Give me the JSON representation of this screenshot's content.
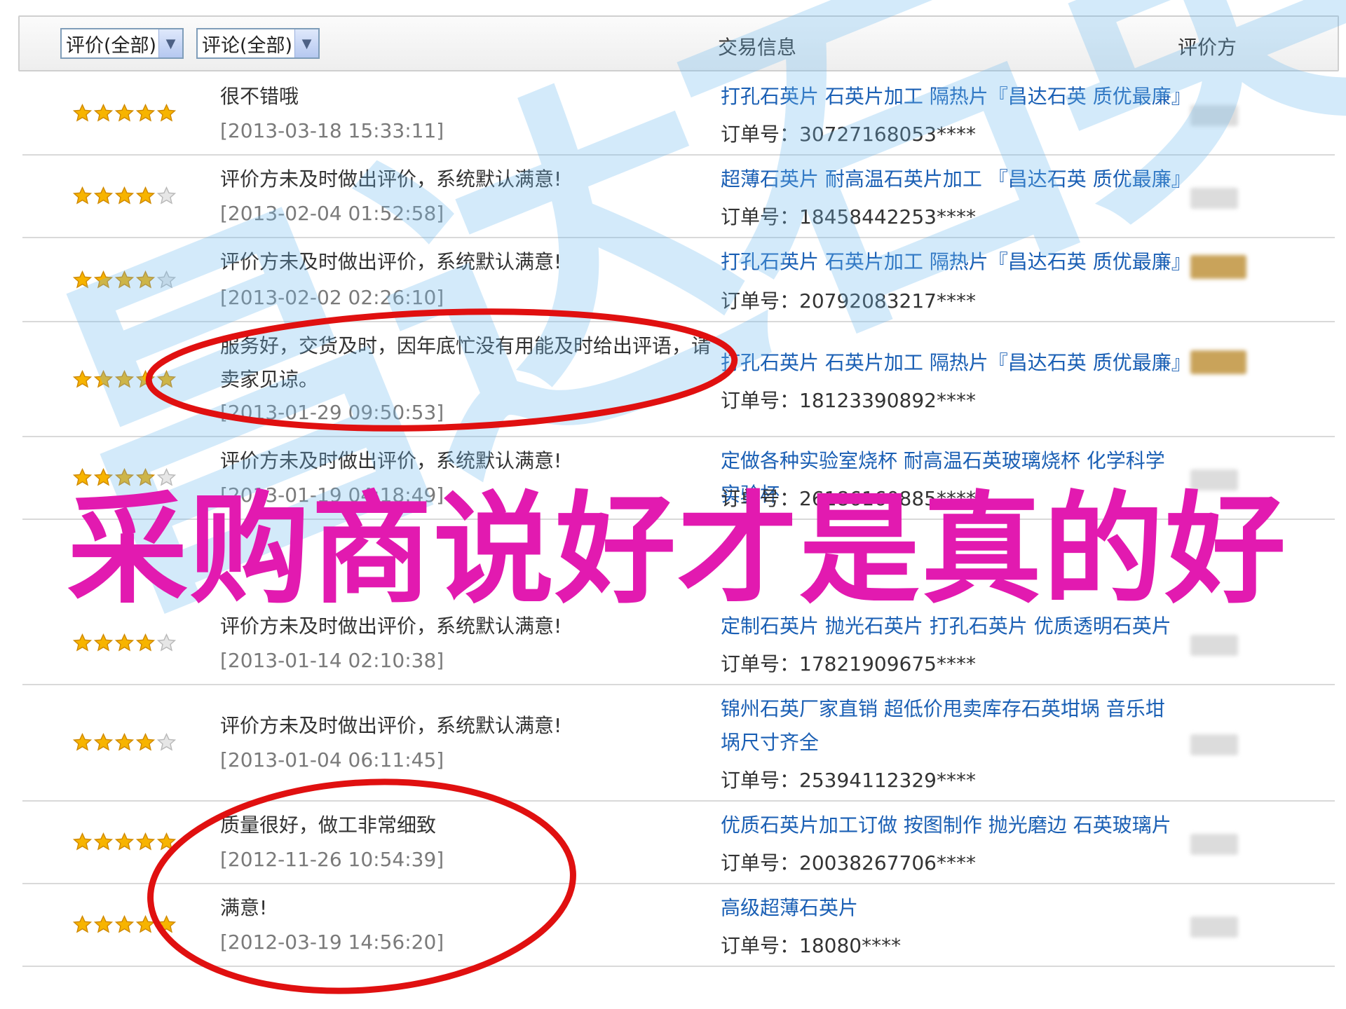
{
  "header": {
    "rating_filter": "评价(全部)",
    "comment_filter": "评论(全部)",
    "trade_info": "交易信息",
    "rater": "评价方"
  },
  "rows": [
    {
      "stars": 5,
      "comment": "很不错哦",
      "date": "[2013-03-18 15:33:11]",
      "item": "打孔石英片 石英片加工 隔热片『昌达石英 质优最廉』",
      "order": "订单号：30727168053****"
    },
    {
      "stars": 4,
      "comment": "评价方未及时做出评价，系统默认满意!",
      "date": "[2013-02-04 01:52:58]",
      "item": "超薄石英片 耐高温石英片加工 『昌达石英 质优最廉』",
      "order": "订单号：18458442253****"
    },
    {
      "stars": 4,
      "comment": "评价方未及时做出评价，系统默认满意!",
      "date": "[2013-02-02 02:26:10]",
      "item": "打孔石英片 石英片加工 隔热片『昌达石英 质优最廉』",
      "order": "订单号：20792083217****"
    },
    {
      "stars": 5,
      "comment": "服务好，交货及时，因年底忙没有用能及时给出评语，请卖家见谅。",
      "date": "[2013-01-29 09:50:53]",
      "item": "打孔石英片 石英片加工 隔热片『昌达石英 质优最廉』",
      "order": "订单号：18123390892****"
    },
    {
      "stars": 4,
      "comment": "评价方未及时做出评价，系统默认满意!",
      "date": "[2013-01-19 04:18:49]",
      "item": "定做各种实验室烧杯 耐高温石英玻璃烧杯 化学科学实验杯",
      "order": "订单号：26186160885****"
    },
    {
      "stars": 4,
      "comment": "评价方未及时做出评价，系统默认满意!",
      "date": "[2013-01-14 02:10:38]",
      "item": "定制石英片 抛光石英片 打孔石英片 优质透明石英片",
      "order": "订单号：17821909675****"
    },
    {
      "stars": 4,
      "comment": "评价方未及时做出评价，系统默认满意!",
      "date": "[2013-01-04 06:11:45]",
      "item": "锦州石英厂家直销 超低价甩卖库存石英坩埚 音乐坩埚尺寸齐全",
      "order": "订单号：25394112329****"
    },
    {
      "stars": 5,
      "comment": "质量很好，做工非常细致",
      "date": "[2012-11-26 10:54:39]",
      "item": "优质石英片加工订做 按图制作 抛光磨边 石英玻璃片",
      "order": "订单号：20038267706****"
    },
    {
      "stars": 5,
      "comment": "满意!",
      "date": "[2012-03-19 14:56:20]",
      "item": "高级超薄石英片",
      "order": "订单号：18080****"
    }
  ],
  "overlay": {
    "slogan": "采购商说好才是真的好",
    "watermark": "昌达石英"
  },
  "colors": {
    "link": "#1a5fb4",
    "star_gold": "#f7b400",
    "slogan": "#e21ab0",
    "annotation_red": "#e01010"
  }
}
